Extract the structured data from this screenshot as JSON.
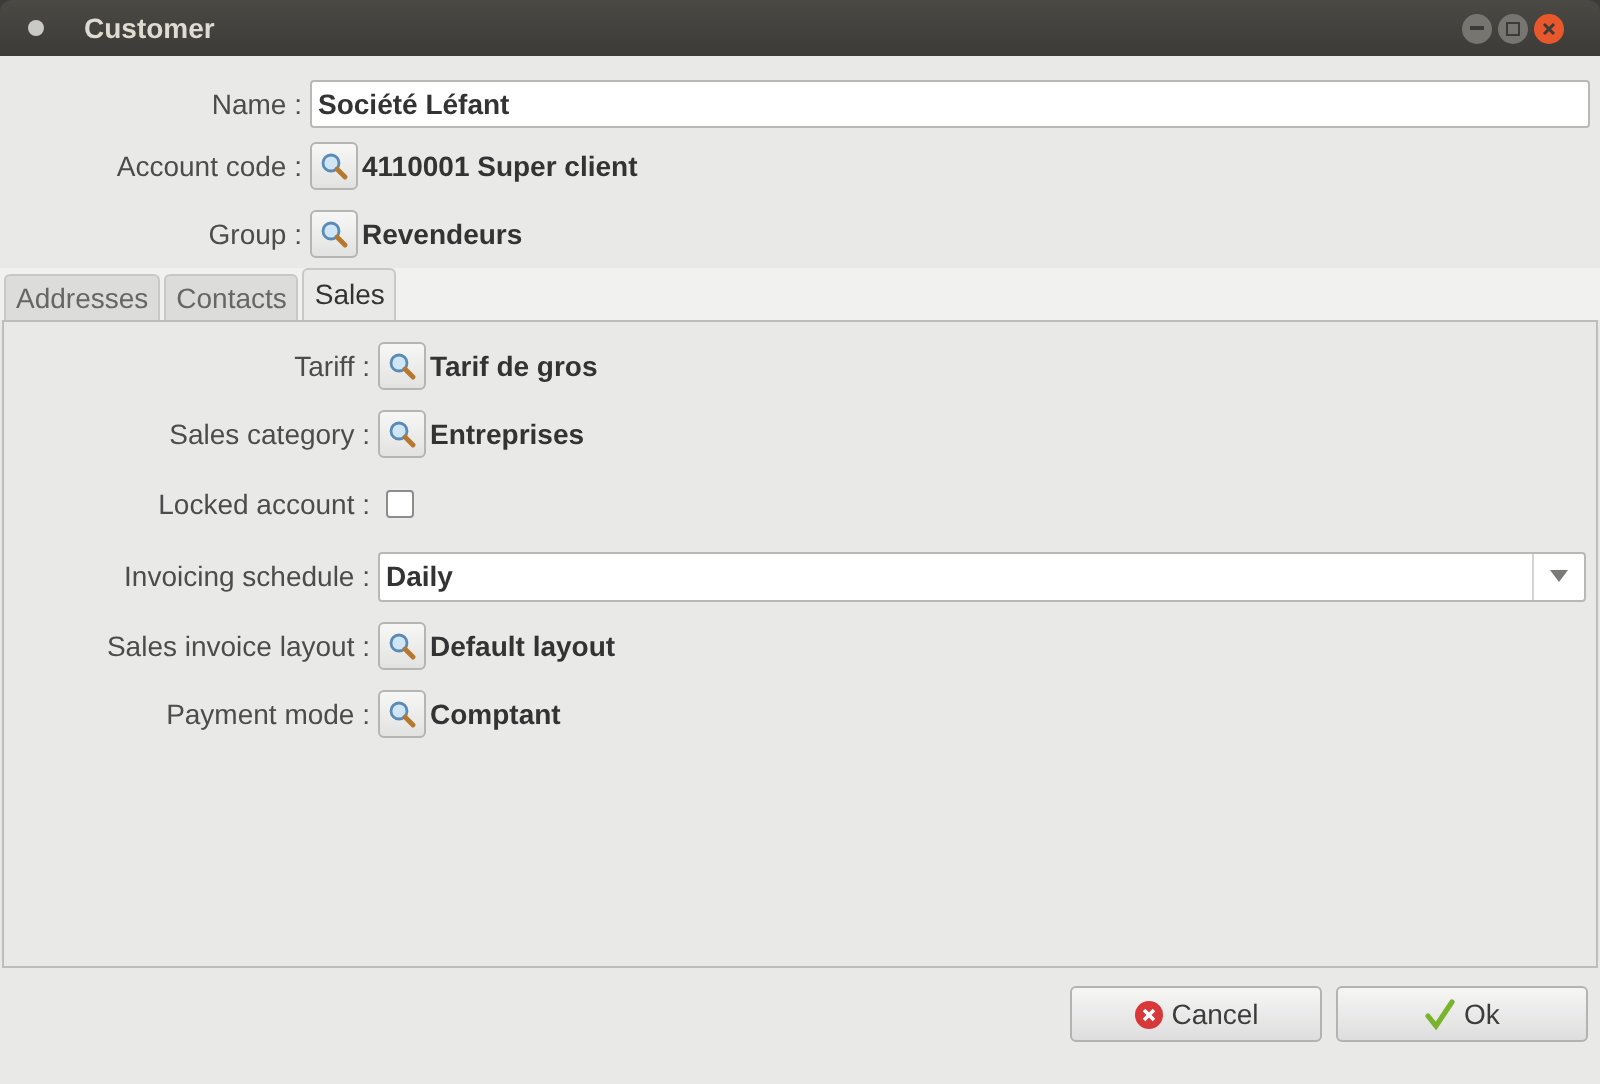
{
  "window": {
    "title": "Customer"
  },
  "header_fields": [
    {
      "kind": "text",
      "label": "Name :",
      "value": "Société Léfant"
    },
    {
      "kind": "lookup",
      "label": "Account code :",
      "value": "4110001 Super client"
    },
    {
      "kind": "lookup",
      "label": "Group :",
      "value": "Revendeurs"
    }
  ],
  "tabs": [
    {
      "label": "Addresses",
      "selected": false
    },
    {
      "label": "Contacts",
      "selected": false
    },
    {
      "label": "Sales",
      "selected": true
    }
  ],
  "sales_fields": [
    {
      "kind": "lookup",
      "label": "Tariff :",
      "value": "Tarif de gros"
    },
    {
      "kind": "lookup",
      "label": "Sales category :",
      "value": "Entreprises"
    },
    {
      "kind": "checkbox",
      "label": "Locked account :",
      "checked": false
    },
    {
      "kind": "combo",
      "label": "Invoicing schedule :",
      "value": "Daily"
    },
    {
      "kind": "lookup",
      "label": "Sales invoice layout :",
      "value": "Default layout"
    },
    {
      "kind": "lookup",
      "label": "Payment mode :",
      "value": "Comptant"
    }
  ],
  "buttons": [
    {
      "kind": "cancel",
      "label": "Cancel"
    },
    {
      "kind": "ok",
      "label": "Ok"
    }
  ]
}
